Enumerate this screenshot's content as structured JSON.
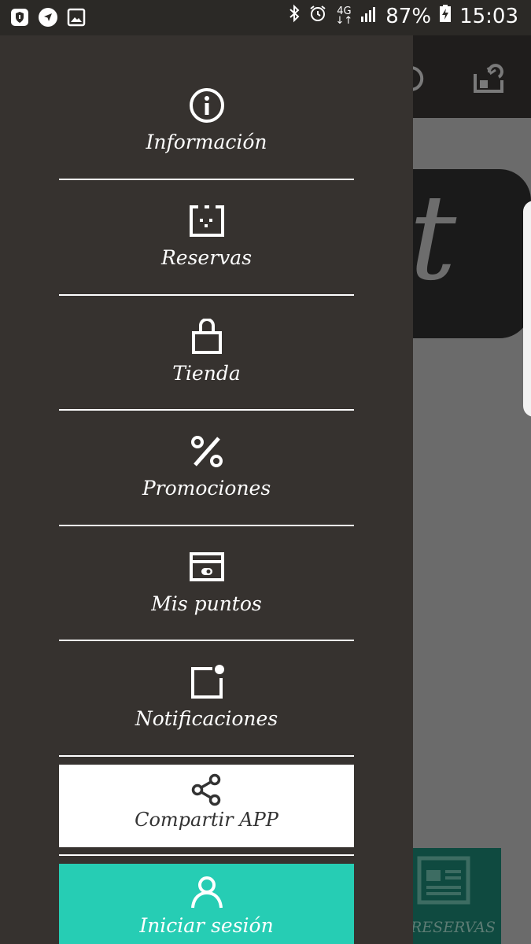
{
  "status_bar": {
    "network_top": "4G",
    "network_bottom": "↓↑",
    "battery": "87%",
    "time": "15:03",
    "icons": [
      "shield-icon",
      "navigation-icon",
      "image-icon",
      "bluetooth-icon",
      "alarm-icon",
      "signal-icon",
      "battery-charging-icon"
    ]
  },
  "drawer": {
    "items": [
      {
        "label": "Información",
        "icon": "info-icon"
      },
      {
        "label": "Reservas",
        "icon": "reservas-icon"
      },
      {
        "label": "Tienda",
        "icon": "shopping-bag-icon"
      },
      {
        "label": "Promociones",
        "icon": "percent-icon"
      },
      {
        "label": "Mis puntos",
        "icon": "points-card-icon"
      },
      {
        "label": "Notificaciones",
        "icon": "notification-icon"
      }
    ],
    "share_label": "Compartir APP",
    "login_label": "Iniciar sesión"
  },
  "background": {
    "bottom_tab_label": "RESERVAS"
  },
  "colors": {
    "drawer_bg": "#36322f",
    "login_accent": "#26cdb4",
    "status_bar_bg": "#2b2926"
  }
}
